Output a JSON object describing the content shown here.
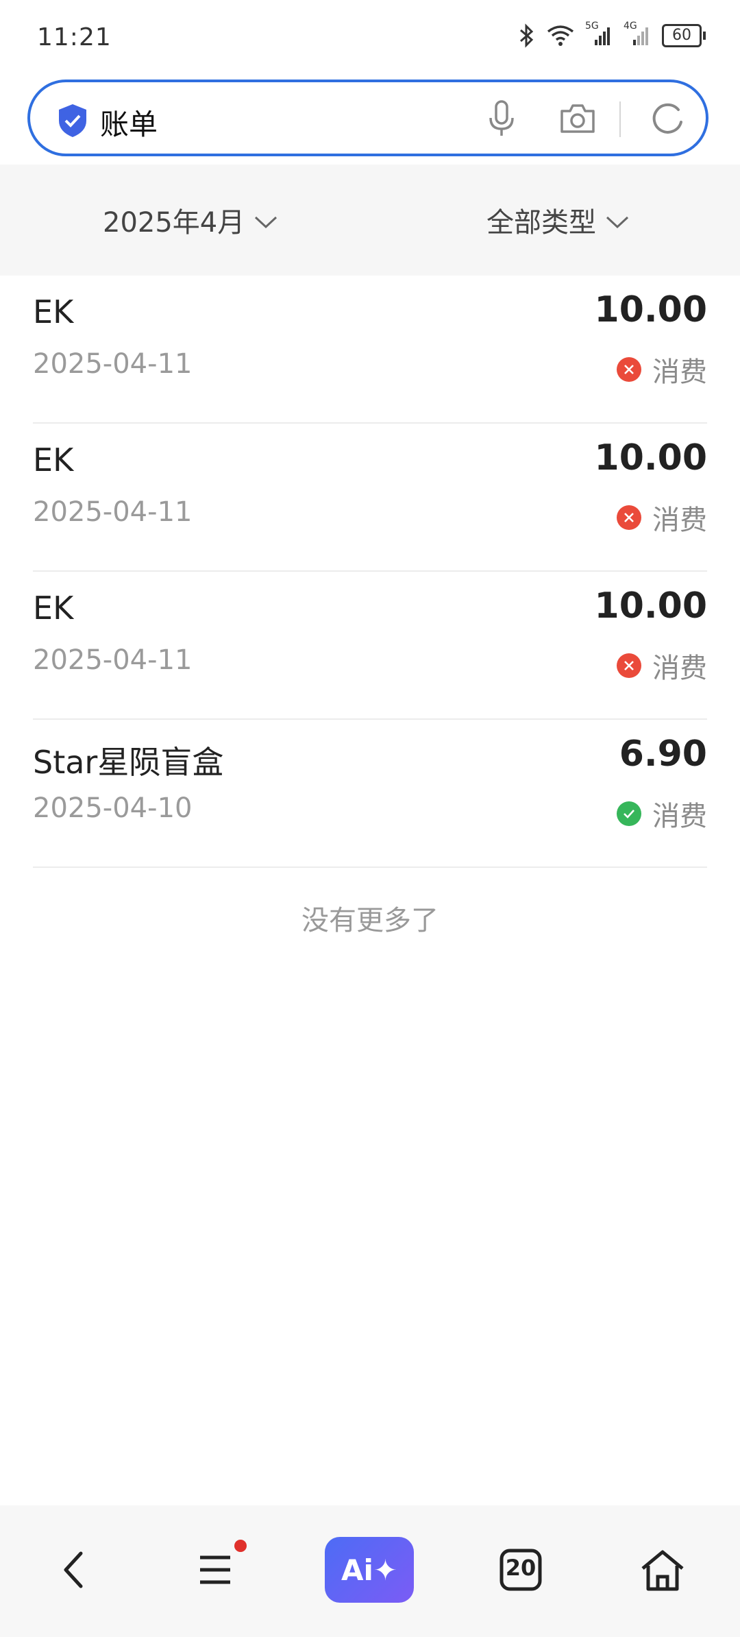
{
  "status_bar": {
    "time": "11:21",
    "battery": "60",
    "network_1": "5G",
    "network_2": "4G"
  },
  "search": {
    "query": "账单"
  },
  "filters": {
    "month": "2025年4月",
    "type": "全部类型"
  },
  "bills": [
    {
      "name": "EK",
      "date": "2025-04-11",
      "amount": "10.00",
      "status": "消费",
      "state": "failed"
    },
    {
      "name": "EK",
      "date": "2025-04-11",
      "amount": "10.00",
      "status": "消费",
      "state": "failed"
    },
    {
      "name": "EK",
      "date": "2025-04-11",
      "amount": "10.00",
      "status": "消费",
      "state": "failed"
    },
    {
      "name": "Star星陨盲盒",
      "date": "2025-04-10",
      "amount": "6.90",
      "status": "消费",
      "state": "success"
    }
  ],
  "footer_text": "没有更多了",
  "bottom_nav": {
    "ai_label": "Ai✦",
    "tabs_count": "20"
  },
  "colors": {
    "accent": "#2f6fe0",
    "fail": "#ea4a3a",
    "success": "#36b65a"
  },
  "icons": [
    "bluetooth-icon",
    "wifi-icon",
    "signal-icon",
    "battery-icon",
    "shield-icon",
    "microphone-icon",
    "camera-icon",
    "refresh-icon",
    "chevron-down-icon",
    "close-icon",
    "check-icon",
    "back-icon",
    "menu-icon",
    "tabs-icon",
    "home-icon"
  ]
}
